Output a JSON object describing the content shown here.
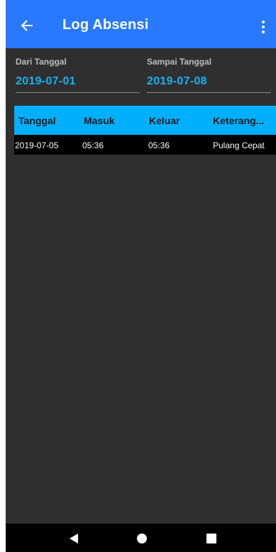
{
  "app_bar": {
    "title": "Log Absensi",
    "back_icon": "arrow-left-icon",
    "menu_icon": "more-vertical-icon",
    "color": "#2979ff"
  },
  "filters": {
    "from": {
      "label": "Dari Tanggal",
      "value": "2019-07-01"
    },
    "to": {
      "label": "Sampai Tanggal",
      "value": "2019-07-08"
    },
    "value_color": "#1ab0f0"
  },
  "table": {
    "header_color": "#00b0ff",
    "columns": [
      "Tanggal",
      "Masuk",
      "Keluar",
      "Keterang..."
    ],
    "rows": [
      {
        "tanggal": "2019-07-05",
        "masuk": "05:36",
        "keluar": "05:36",
        "keterangan": "Pulang Cepat"
      }
    ]
  },
  "system_nav": {
    "back_icon": "triangle-back-icon",
    "home_icon": "circle-home-icon",
    "recents_icon": "square-recents-icon"
  }
}
